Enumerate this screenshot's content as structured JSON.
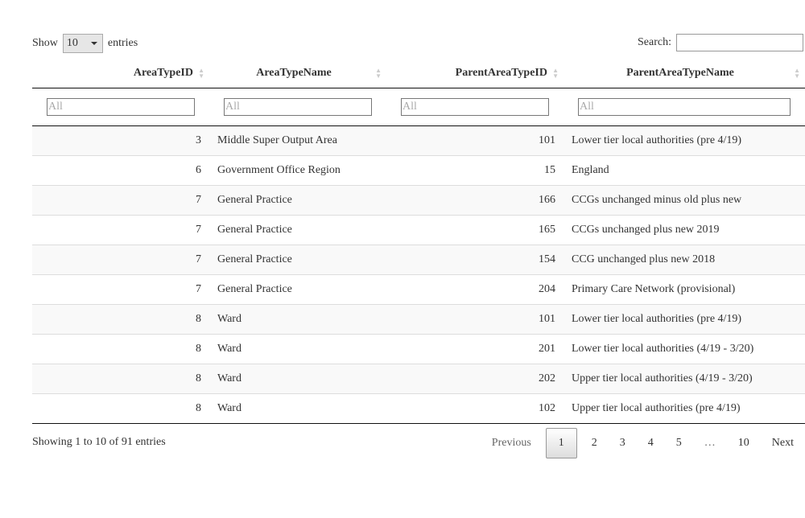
{
  "length": {
    "show": "Show",
    "value": "10",
    "entries": "entries"
  },
  "search": {
    "label": "Search:",
    "value": ""
  },
  "columns": [
    "AreaTypeID",
    "AreaTypeName",
    "ParentAreaTypeID",
    "ParentAreaTypeName"
  ],
  "filter_placeholder": "All",
  "rows": [
    [
      "3",
      "Middle Super Output Area",
      "101",
      "Lower tier local authorities (pre 4/19)"
    ],
    [
      "6",
      "Government Office Region",
      "15",
      "England"
    ],
    [
      "7",
      "General Practice",
      "166",
      "CCGs unchanged minus old plus new"
    ],
    [
      "7",
      "General Practice",
      "165",
      "CCGs unchanged plus new 2019"
    ],
    [
      "7",
      "General Practice",
      "154",
      "CCG unchanged plus new 2018"
    ],
    [
      "7",
      "General Practice",
      "204",
      "Primary Care Network (provisional)"
    ],
    [
      "8",
      "Ward",
      "101",
      "Lower tier local authorities (pre 4/19)"
    ],
    [
      "8",
      "Ward",
      "201",
      "Lower tier local authorities (4/19 - 3/20)"
    ],
    [
      "8",
      "Ward",
      "202",
      "Upper tier local authorities (4/19 - 3/20)"
    ],
    [
      "8",
      "Ward",
      "102",
      "Upper tier local authorities (pre 4/19)"
    ]
  ],
  "info": "Showing 1 to 10 of 91 entries",
  "pagination": {
    "previous": "Previous",
    "pages": [
      "1",
      "2",
      "3",
      "4",
      "5",
      "…",
      "10"
    ],
    "current": "1",
    "next": "Next"
  }
}
